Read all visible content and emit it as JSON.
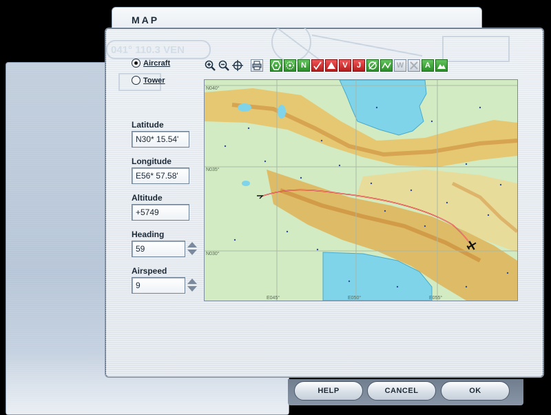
{
  "window": {
    "title": "MAP"
  },
  "view_options": [
    {
      "label": "Aircraft",
      "selected": true
    },
    {
      "label": "Tower",
      "selected": false
    }
  ],
  "fields": {
    "latitude": {
      "label": "Latitude",
      "value": "N30* 15.54'"
    },
    "longitude": {
      "label": "Longitude",
      "value": "E56* 57.58'"
    },
    "altitude": {
      "label": "Altitude",
      "value": "+5749"
    },
    "heading": {
      "label": "Heading",
      "value": "59"
    },
    "airspeed": {
      "label": "Airspeed",
      "value": "9"
    }
  },
  "toolbar": [
    {
      "icon": "zoom-in-icon"
    },
    {
      "icon": "zoom-out-icon"
    },
    {
      "icon": "center-aircraft-icon"
    },
    {
      "icon": "print-icon"
    },
    {
      "icon": "vor-icon"
    },
    {
      "icon": "ndb-icon"
    },
    {
      "icon": "ils-icon",
      "text": "N"
    },
    {
      "icon": "intersection-icon"
    },
    {
      "icon": "airport-icon"
    },
    {
      "icon": "victor-airway-icon",
      "text": "V"
    },
    {
      "icon": "jet-airway-icon",
      "text": "J"
    },
    {
      "icon": "compass-rose-icon"
    },
    {
      "icon": "route-icon"
    },
    {
      "icon": "waypoint-icon-disabled",
      "text": "W"
    },
    {
      "icon": "airspace-icon-disabled"
    },
    {
      "icon": "labels-icon",
      "text": "A"
    },
    {
      "icon": "terrain-icon"
    }
  ],
  "map": {
    "grid_labels": {
      "lat_top": "N040°",
      "lat_mid": "N035°",
      "lat_bottom": "N030°",
      "lon_left": "E045°",
      "lon_mid": "E050°",
      "lon_right": "E055°"
    },
    "colors": {
      "water": "#7fd4ea",
      "lowland": "#cfe9bf",
      "highland": "#e8c46a",
      "mountain": "#d98f3a",
      "flight_path": "#d92222"
    }
  },
  "buttons": {
    "help": "HELP",
    "cancel": "CANCEL",
    "ok": "OK"
  },
  "watermark": {
    "radial_text": "041° 110.3 VEN"
  }
}
